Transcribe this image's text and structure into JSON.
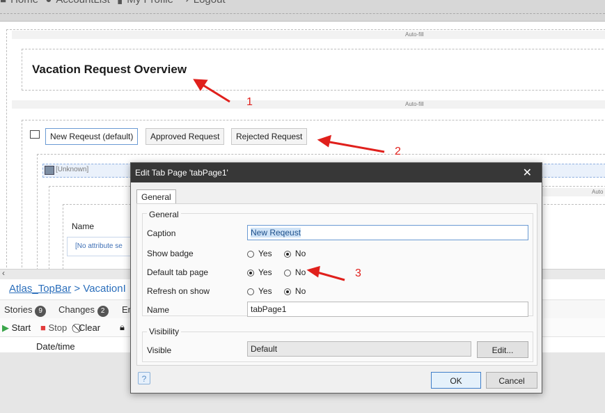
{
  "topnav": {
    "items": [
      "Home",
      "AccountList",
      "My Profile",
      "Logout"
    ]
  },
  "canvas": {
    "autofill_label_1": "Auto-fill",
    "autofill_label_2": "Auto-fill",
    "autofill_label_3": "Auto",
    "title": "Vacation Request Overview",
    "tabs": [
      "New Reqeust (default)",
      "Approved Request",
      "Rejected Request"
    ],
    "unknown_label": "[Unknown]",
    "name_label": "Name",
    "no_attribute": "[No attribute se"
  },
  "annotations": [
    "1",
    "2",
    "3"
  ],
  "bottom": {
    "breadcrumb_link": "Atlas_TopBar",
    "breadcrumb_sep": ">",
    "breadcrumb_current": "VacationI",
    "tabs": [
      {
        "label": "Stories",
        "count": "9"
      },
      {
        "label": "Changes",
        "count": "2"
      },
      {
        "label": "Er",
        "count": ""
      }
    ],
    "toolbar": {
      "start": "Start",
      "stop": "Stop",
      "clear": "Clear"
    },
    "column_header": "Date/time"
  },
  "dialog": {
    "title": "Edit Tab Page 'tabPage1'",
    "tab": "General",
    "group_general": "General",
    "caption_label": "Caption",
    "caption_value": "New Reqeust",
    "show_badge_label": "Show badge",
    "default_tab_label": "Default tab page",
    "refresh_label": "Refresh on show",
    "yes": "Yes",
    "no": "No",
    "name_label": "Name",
    "name_value": "tabPage1",
    "group_visibility": "Visibility",
    "visible_label": "Visible",
    "visible_value": "Default",
    "edit_button": "Edit...",
    "ok_button": "OK",
    "cancel_button": "Cancel"
  },
  "colors": {
    "dialog_titlebar": "#373737",
    "annotation_red": "#e0201c",
    "link_blue": "#2a6ebb"
  }
}
